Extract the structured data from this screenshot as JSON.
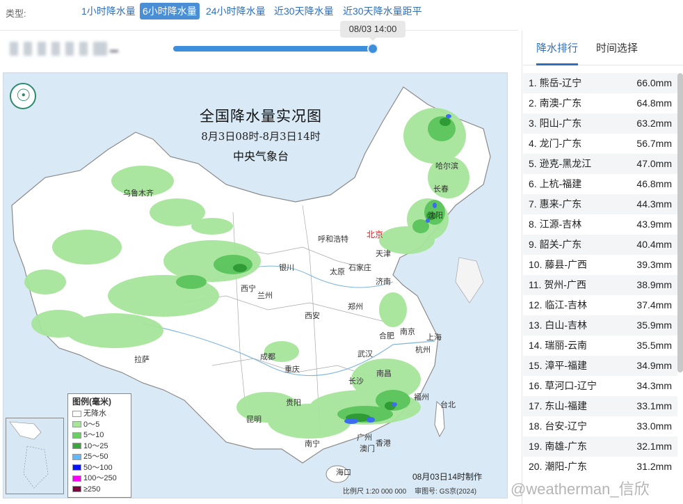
{
  "type_bar": {
    "label": "类型:",
    "options": [
      "1小时降水量",
      "6小时降水量",
      "24小时降水量",
      "近30天降水量",
      "近30天降水量距平"
    ],
    "selected": "6小时降水量"
  },
  "timeline": {
    "current_time": "08/03 14:00",
    "progress": 1.0
  },
  "map": {
    "title": "全国降水量实况图",
    "subtitle": "8月3日08时-8月3日14时",
    "organization": "中央气象台",
    "made_at": "08月03日14时制作",
    "scale": "比例尺 1:20 000 000",
    "review_number": "审图号: GS京(2024)",
    "capital": "北京",
    "cities": [
      "乌鲁木齐",
      "哈尔滨",
      "长春",
      "沈阳",
      "呼和浩特",
      "天津",
      "银川",
      "太原",
      "石家庄",
      "济南",
      "西宁",
      "兰州",
      "郑州",
      "西安",
      "合肥",
      "南京",
      "上海",
      "拉萨",
      "成都",
      "武汉",
      "杭州",
      "重庆",
      "南昌",
      "长沙",
      "福州",
      "贵阳",
      "台北",
      "昆明",
      "广州",
      "香港",
      "澳门",
      "南宁",
      "海口"
    ],
    "legend": {
      "title": "图例(毫米)",
      "items": [
        {
          "label": "无降水",
          "color": "#ffffff"
        },
        {
          "label": "0～5",
          "color": "#a6e59a"
        },
        {
          "label": "5～10",
          "color": "#6ccf63"
        },
        {
          "label": "10～25",
          "color": "#3aa53a"
        },
        {
          "label": "25～50",
          "color": "#61b8ff"
        },
        {
          "label": "50～100",
          "color": "#0a14f0"
        },
        {
          "label": "100～250",
          "color": "#fa00fa"
        },
        {
          "label": "≥250",
          "color": "#800040"
        }
      ]
    }
  },
  "ranking_panel": {
    "tabs": [
      "降水排行",
      "时间选择"
    ],
    "active_tab": "降水排行",
    "rows": [
      {
        "name": "1. 熊岳-辽宁",
        "value": "66.0mm"
      },
      {
        "name": "2. 南澳-广东",
        "value": "64.8mm"
      },
      {
        "name": "3. 阳山-广东",
        "value": "63.2mm"
      },
      {
        "name": "4. 龙门-广东",
        "value": "56.7mm"
      },
      {
        "name": "5. 逊克-黑龙江",
        "value": "47.0mm"
      },
      {
        "name": "6. 上杭-福建",
        "value": "46.8mm"
      },
      {
        "name": "7. 惠来-广东",
        "value": "44.3mm"
      },
      {
        "name": "8. 江源-吉林",
        "value": "43.9mm"
      },
      {
        "name": "9. 韶关-广东",
        "value": "40.4mm"
      },
      {
        "name": "10. 藤县-广西",
        "value": "39.3mm"
      },
      {
        "name": "11. 贺州-广西",
        "value": "38.9mm"
      },
      {
        "name": "12. 临江-吉林",
        "value": "37.4mm"
      },
      {
        "name": "13. 白山-吉林",
        "value": "35.9mm"
      },
      {
        "name": "14. 瑞丽-云南",
        "value": "35.5mm"
      },
      {
        "name": "15. 漳平-福建",
        "value": "34.9mm"
      },
      {
        "name": "16. 草河口-辽宁",
        "value": "34.3mm"
      },
      {
        "name": "17. 东山-福建",
        "value": "33.1mm"
      },
      {
        "name": "18. 台安-辽宁",
        "value": "33.0mm"
      },
      {
        "name": "19. 南雄-广东",
        "value": "32.1mm"
      },
      {
        "name": "20. 潮阳-广东",
        "value": "31.2mm"
      }
    ]
  },
  "watermark": "@weatherman_信欣"
}
